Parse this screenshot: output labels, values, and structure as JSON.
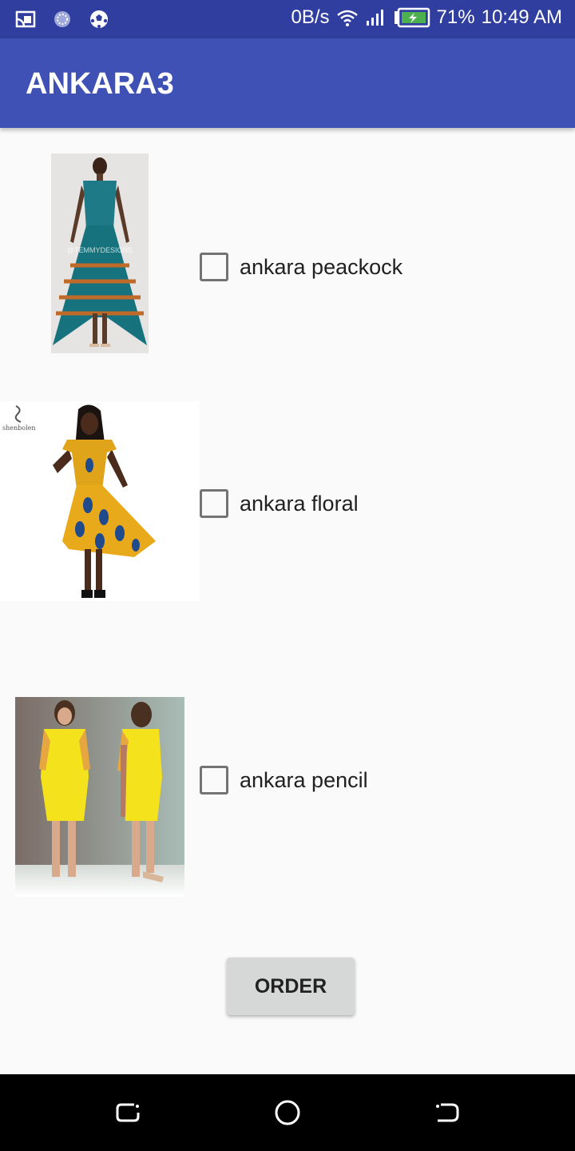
{
  "status": {
    "net_speed": "0B/s",
    "battery": "71%",
    "time": "10:49 AM"
  },
  "app": {
    "title": "ANKARA3"
  },
  "products": [
    {
      "label": "ankara peackock",
      "checked": false,
      "watermark": "@TEMMYDESIGNS"
    },
    {
      "label": "ankara floral",
      "checked": false,
      "logo_text": "shenbolen"
    },
    {
      "label": "ankara pencil",
      "checked": false
    }
  ],
  "order_button": {
    "label": "ORDER"
  },
  "colors": {
    "status_bar": "#303f9f",
    "app_bar": "#3f51b5",
    "background": "#fafafa",
    "button": "#d6d7d7"
  },
  "icons": {
    "status_left": [
      "cast-icon",
      "sync-icon",
      "soccer-ball-icon"
    ],
    "status_right": [
      "wifi-icon",
      "signal-icon",
      "battery-charging-icon"
    ],
    "nav": [
      "recents-icon",
      "home-icon",
      "back-icon"
    ]
  }
}
